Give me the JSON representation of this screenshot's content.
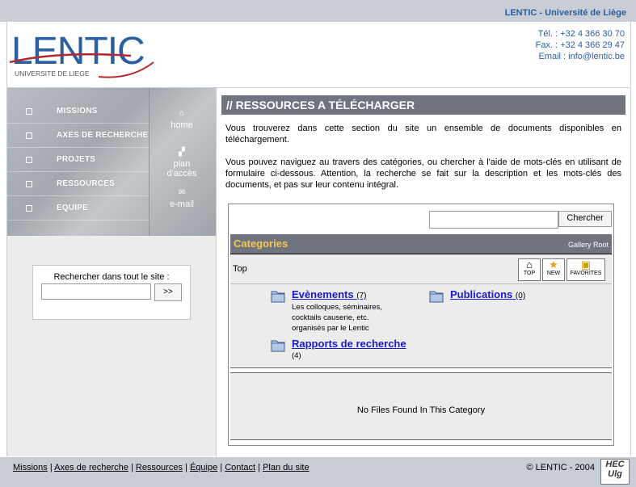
{
  "header": {
    "brand": "LENTIC - Université de Liège",
    "logo_text": "LENTIC",
    "logo_subtitle": "UNIVERSITE DE LIEGE",
    "phone": "Tél. : +32 4 366 30 70",
    "fax": "Fax. : +32 4 366 29 47",
    "email": "Email : info@lentic.be"
  },
  "nav": {
    "items": [
      {
        "label": "Missions"
      },
      {
        "label": "Axes de recherche"
      },
      {
        "label": "Projets"
      },
      {
        "label": "Ressources"
      },
      {
        "label": "Equipe"
      }
    ],
    "quick": [
      {
        "label": "home",
        "icon": "house-icon"
      },
      {
        "label": "plan d'accès",
        "icon": "sitemap-icon"
      },
      {
        "label": "e-mail",
        "icon": "envelope-icon"
      }
    ]
  },
  "site_search": {
    "label": "Rechercher dans tout le site :",
    "value": "",
    "button": ">>"
  },
  "main": {
    "title": "// RESSOURCES A TÉLÉCHARGER",
    "para1": "Vous trouverez dans cette section du site un ensemble de documents disponibles en téléchargement.",
    "para2": "Vous pouvez naviguez au travers des catégories, ou chercher à l'aide de mots-clés en utilisant de formulaire ci-dessous. Attention, la recherche se fait sur la description et les mots-clés des documents, et pas sur leur contenu intégral."
  },
  "gallery": {
    "search_value": "",
    "search_button": "Chercher",
    "categories_title": "Categories",
    "root_label": "Gallery Root",
    "breadcrumb": "Top",
    "icon_buttons": [
      {
        "label": "TOP",
        "icon": "house-icon"
      },
      {
        "label": "NEW",
        "icon": "star-icon"
      },
      {
        "label": "FAVORITES",
        "icon": "favorites-icon"
      }
    ],
    "categories": [
      {
        "name": "Evènements",
        "count": "(7)",
        "description": "Les colloques, séminaires, cocktails causerie, etc. organisés par le Lentic"
      },
      {
        "name": "Publications",
        "count": "(0)",
        "description": ""
      },
      {
        "name": "Rapports de recherche",
        "count": "(4)",
        "description": ""
      }
    ],
    "empty_message": "No Files Found In This Category"
  },
  "footer": {
    "links": [
      "Missions",
      "Axes de recherche",
      "Ressources",
      "Équipe",
      "Contact",
      "Plan du site"
    ],
    "separator": "|",
    "copyright": "© LENTIC - 2004",
    "badge": "HEC Ulg"
  },
  "colors": {
    "accent_blue": "#2a5fa0",
    "header_gray": "#c8ccd4",
    "title_bar": "#6f7480",
    "categories_yellow": "#f6c64e",
    "link_blue": "#1a1ad2"
  }
}
